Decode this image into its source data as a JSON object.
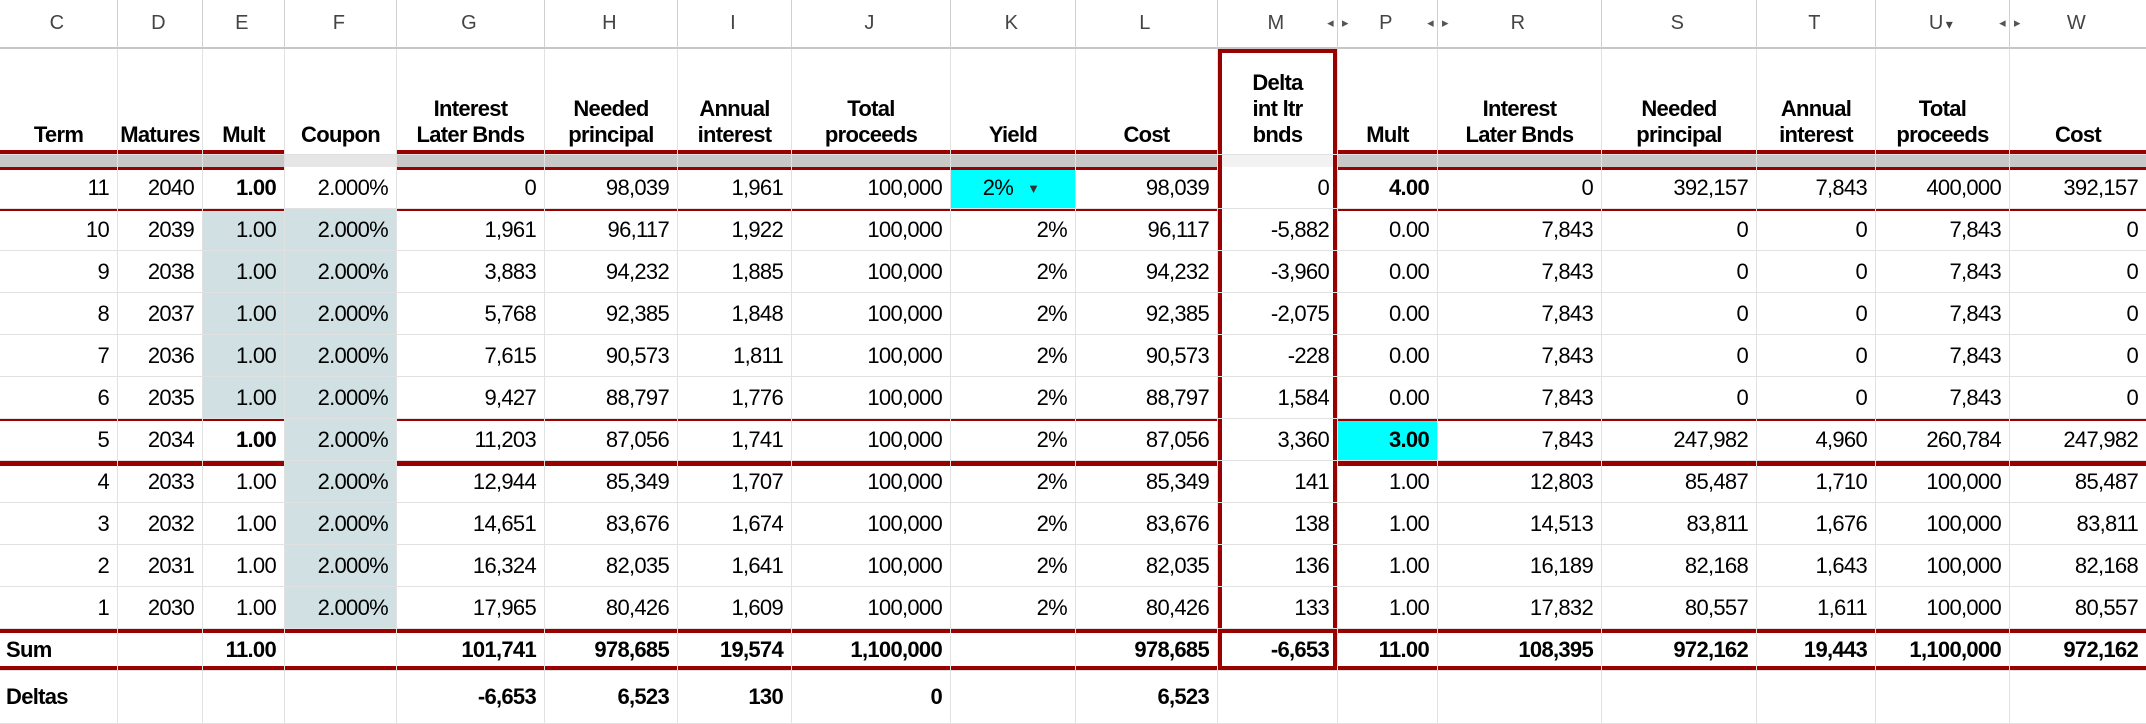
{
  "columns": [
    {
      "letter": "C",
      "header": [
        "Term"
      ]
    },
    {
      "letter": "D",
      "header": [
        "Matures"
      ]
    },
    {
      "letter": "E",
      "header": [
        "Mult"
      ]
    },
    {
      "letter": "F",
      "header": [
        "Coupon"
      ]
    },
    {
      "letter": "G",
      "header": [
        "Interest",
        "Later Bnds"
      ]
    },
    {
      "letter": "H",
      "header": [
        "Needed",
        "principal"
      ]
    },
    {
      "letter": "I",
      "header": [
        "Annual",
        "interest"
      ]
    },
    {
      "letter": "J",
      "header": [
        "Total",
        "proceeds"
      ]
    },
    {
      "letter": "K",
      "header": [
        "Yield"
      ]
    },
    {
      "letter": "L",
      "header": [
        "Cost"
      ]
    },
    {
      "letter": "M",
      "header": [
        "Delta",
        "int ltr",
        "bnds"
      ]
    },
    {
      "letter": "P",
      "header": [
        "Mult"
      ]
    },
    {
      "letter": "R",
      "header": [
        "Interest",
        "Later Bnds"
      ]
    },
    {
      "letter": "S",
      "header": [
        "Needed",
        "principal"
      ]
    },
    {
      "letter": "T",
      "header": [
        "Annual",
        "interest"
      ]
    },
    {
      "letter": "U",
      "header": [
        "Total",
        "proceeds"
      ]
    },
    {
      "letter": "W",
      "header": [
        "Cost"
      ]
    }
  ],
  "hidden_column_markers": {
    "M": "right",
    "P": "both",
    "R": "left",
    "U": "right",
    "W": "left"
  },
  "filter_column": "U",
  "rows": [
    [
      "11",
      "2040",
      "1.00",
      "2.000%",
      "0",
      "98,039",
      "1,961",
      "100,000",
      "2%",
      "98,039",
      "0",
      "4.00",
      "0",
      "392,157",
      "7,843",
      "400,000",
      "392,157"
    ],
    [
      "10",
      "2039",
      "1.00",
      "2.000%",
      "1,961",
      "96,117",
      "1,922",
      "100,000",
      "2%",
      "96,117",
      "-5,882",
      "0.00",
      "7,843",
      "0",
      "0",
      "7,843",
      "0"
    ],
    [
      "9",
      "2038",
      "1.00",
      "2.000%",
      "3,883",
      "94,232",
      "1,885",
      "100,000",
      "2%",
      "94,232",
      "-3,960",
      "0.00",
      "7,843",
      "0",
      "0",
      "7,843",
      "0"
    ],
    [
      "8",
      "2037",
      "1.00",
      "2.000%",
      "5,768",
      "92,385",
      "1,848",
      "100,000",
      "2%",
      "92,385",
      "-2,075",
      "0.00",
      "7,843",
      "0",
      "0",
      "7,843",
      "0"
    ],
    [
      "7",
      "2036",
      "1.00",
      "2.000%",
      "7,615",
      "90,573",
      "1,811",
      "100,000",
      "2%",
      "90,573",
      "-228",
      "0.00",
      "7,843",
      "0",
      "0",
      "7,843",
      "0"
    ],
    [
      "6",
      "2035",
      "1.00",
      "2.000%",
      "9,427",
      "88,797",
      "1,776",
      "100,000",
      "2%",
      "88,797",
      "1,584",
      "0.00",
      "7,843",
      "0",
      "0",
      "7,843",
      "0"
    ],
    [
      "5",
      "2034",
      "1.00",
      "2.000%",
      "11,203",
      "87,056",
      "1,741",
      "100,000",
      "2%",
      "87,056",
      "3,360",
      "3.00",
      "7,843",
      "247,982",
      "4,960",
      "260,784",
      "247,982"
    ],
    [
      "4",
      "2033",
      "1.00",
      "2.000%",
      "12,944",
      "85,349",
      "1,707",
      "100,000",
      "2%",
      "85,349",
      "141",
      "1.00",
      "12,803",
      "85,487",
      "1,710",
      "100,000",
      "85,487"
    ],
    [
      "3",
      "2032",
      "1.00",
      "2.000%",
      "14,651",
      "83,676",
      "1,674",
      "100,000",
      "2%",
      "83,676",
      "138",
      "1.00",
      "14,513",
      "83,811",
      "1,676",
      "100,000",
      "83,811"
    ],
    [
      "2",
      "2031",
      "1.00",
      "2.000%",
      "16,324",
      "82,035",
      "1,641",
      "100,000",
      "2%",
      "82,035",
      "136",
      "1.00",
      "16,189",
      "82,168",
      "1,643",
      "100,000",
      "82,168"
    ],
    [
      "1",
      "2030",
      "1.00",
      "2.000%",
      "17,965",
      "80,426",
      "1,609",
      "100,000",
      "2%",
      "80,426",
      "133",
      "1.00",
      "17,832",
      "80,557",
      "1,611",
      "100,000",
      "80,557"
    ]
  ],
  "sum_row": [
    "Sum",
    "",
    "11.00",
    "",
    "101,741",
    "978,685",
    "19,574",
    "1,100,000",
    "",
    "978,685",
    "-6,653",
    "11.00",
    "108,395",
    "972,162",
    "19,443",
    "1,100,000",
    "972,162"
  ],
  "deltas_row": [
    "Deltas",
    "",
    "",
    "",
    "-6,653",
    "6,523",
    "130",
    "0",
    "",
    "6,523",
    "",
    "",
    "",
    "",
    "",
    "",
    ""
  ],
  "colors": {
    "border_red": "#990000",
    "shade": "#d0e0e3",
    "highlight": "#00ffff",
    "separator": "#c8c8c8"
  }
}
